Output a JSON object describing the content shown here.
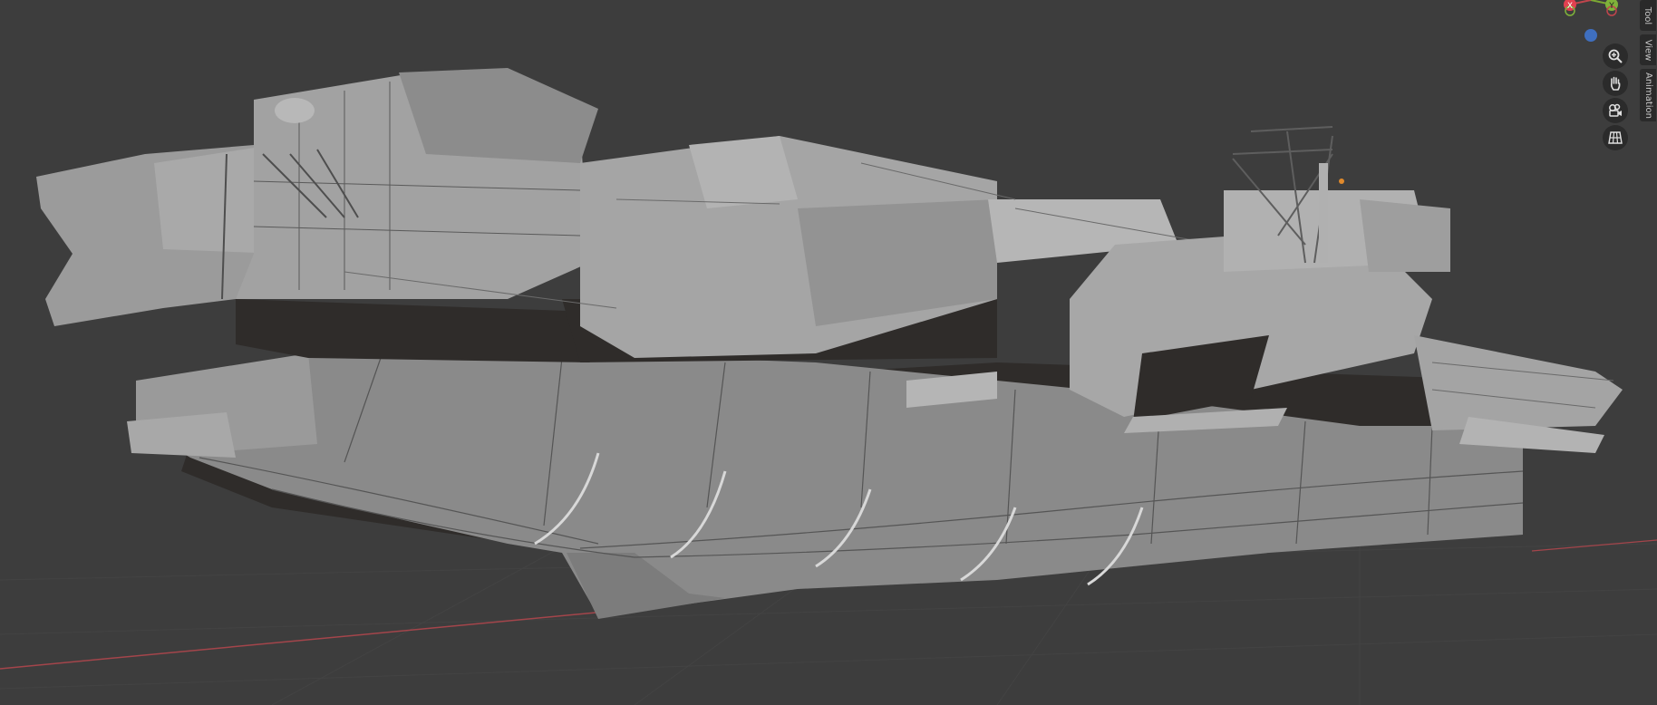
{
  "viewport": {
    "background": "#3d3d3d",
    "axis_x_color": "#c0454c",
    "axis_y_color": "#7ca833"
  },
  "gizmo": {
    "x_label": "X",
    "y_label": "Y",
    "z_color": "#3f6fbf"
  },
  "nav_buttons": [
    {
      "name": "zoom",
      "icon": "zoom-icon"
    },
    {
      "name": "pan",
      "icon": "hand-icon"
    },
    {
      "name": "camera",
      "icon": "camera-icon"
    },
    {
      "name": "ortho",
      "icon": "grid-icon"
    }
  ],
  "sidebar_tabs": {
    "tool": "Tool",
    "view": "View",
    "animation": "Animation"
  },
  "scene": {
    "object": "aircraft carrier model",
    "hull_color": "#8f8f8f",
    "shadow_color": "#2f2c2a",
    "edge_color": "#3a3a3a"
  }
}
